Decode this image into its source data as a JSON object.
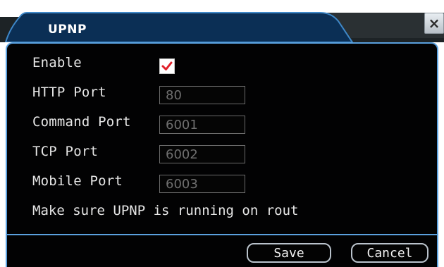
{
  "dialog": {
    "title": "UPNP",
    "close_glyph": "×"
  },
  "form": {
    "enable": {
      "label": "Enable",
      "checked": true
    },
    "http_port": {
      "label": "HTTP Port",
      "value": "80"
    },
    "command_port": {
      "label": "Command Port",
      "value": "6001"
    },
    "tcp_port": {
      "label": "TCP Port",
      "value": "6002"
    },
    "mobile_port": {
      "label": "Mobile Port",
      "value": "6003"
    },
    "note": "Make sure UPNP is running on rout"
  },
  "buttons": {
    "save": "Save",
    "cancel": "Cancel"
  },
  "colors": {
    "title_bar": "#0b2f55",
    "panel_border": "#5aa0de",
    "panel_bg": "#020203",
    "check_mark": "#e0202a"
  }
}
